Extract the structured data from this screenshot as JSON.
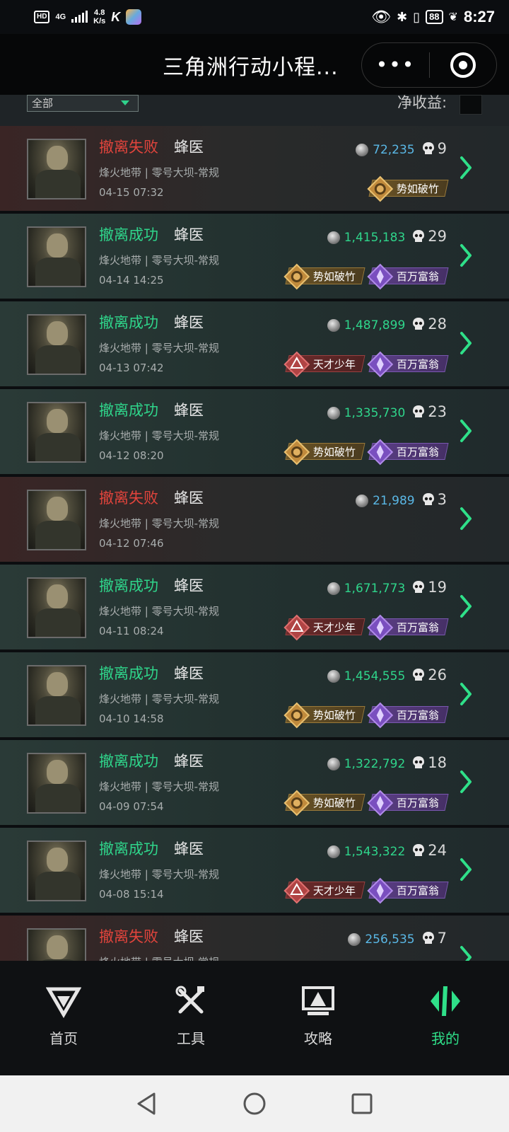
{
  "status_bar": {
    "hd": "HD",
    "net": "4G",
    "speed_value": "4.8",
    "speed_unit": "K/s",
    "app_icon": "K",
    "battery": "88",
    "time": "8:27"
  },
  "header": {
    "title": "三角洲行动小程...",
    "more_label": "•••"
  },
  "filter": {
    "select_value": "全部",
    "net_label": "净收益:"
  },
  "records": [
    {
      "status": "撤离失败",
      "result": "fail",
      "operator": "蜂医",
      "map": "烽火地带 | 零号大坝-常规",
      "time": "04-15 07:32",
      "value": "72,235",
      "kills": "9",
      "badges": [
        {
          "label": "势如破竹",
          "type": "gold"
        }
      ]
    },
    {
      "status": "撤离成功",
      "result": "ok",
      "operator": "蜂医",
      "map": "烽火地带 | 零号大坝-常规",
      "time": "04-14 14:25",
      "value": "1,415,183",
      "kills": "29",
      "badges": [
        {
          "label": "势如破竹",
          "type": "gold"
        },
        {
          "label": "百万富翁",
          "type": "purple"
        }
      ]
    },
    {
      "status": "撤离成功",
      "result": "ok",
      "operator": "蜂医",
      "map": "烽火地带 | 零号大坝-常规",
      "time": "04-13 07:42",
      "value": "1,487,899",
      "kills": "28",
      "badges": [
        {
          "label": "天才少年",
          "type": "red"
        },
        {
          "label": "百万富翁",
          "type": "purple"
        }
      ]
    },
    {
      "status": "撤离成功",
      "result": "ok",
      "operator": "蜂医",
      "map": "烽火地带 | 零号大坝-常规",
      "time": "04-12 08:20",
      "value": "1,335,730",
      "kills": "23",
      "badges": [
        {
          "label": "势如破竹",
          "type": "gold"
        },
        {
          "label": "百万富翁",
          "type": "purple"
        }
      ]
    },
    {
      "status": "撤离失败",
      "result": "fail",
      "operator": "蜂医",
      "map": "烽火地带 | 零号大坝-常规",
      "time": "04-12 07:46",
      "value": "21,989",
      "kills": "3",
      "badges": []
    },
    {
      "status": "撤离成功",
      "result": "ok",
      "operator": "蜂医",
      "map": "烽火地带 | 零号大坝-常规",
      "time": "04-11 08:24",
      "value": "1,671,773",
      "kills": "19",
      "badges": [
        {
          "label": "天才少年",
          "type": "red"
        },
        {
          "label": "百万富翁",
          "type": "purple"
        }
      ]
    },
    {
      "status": "撤离成功",
      "result": "ok",
      "operator": "蜂医",
      "map": "烽火地带 | 零号大坝-常规",
      "time": "04-10 14:58",
      "value": "1,454,555",
      "kills": "26",
      "badges": [
        {
          "label": "势如破竹",
          "type": "gold"
        },
        {
          "label": "百万富翁",
          "type": "purple"
        }
      ]
    },
    {
      "status": "撤离成功",
      "result": "ok",
      "operator": "蜂医",
      "map": "烽火地带 | 零号大坝-常规",
      "time": "04-09 07:54",
      "value": "1,322,792",
      "kills": "18",
      "badges": [
        {
          "label": "势如破竹",
          "type": "gold"
        },
        {
          "label": "百万富翁",
          "type": "purple"
        }
      ]
    },
    {
      "status": "撤离成功",
      "result": "ok",
      "operator": "蜂医",
      "map": "烽火地带 | 零号大坝-常规",
      "time": "04-08 15:14",
      "value": "1,543,322",
      "kills": "24",
      "badges": [
        {
          "label": "天才少年",
          "type": "red"
        },
        {
          "label": "百万富翁",
          "type": "purple"
        }
      ]
    },
    {
      "status": "撤离失败",
      "result": "fail",
      "operator": "蜂医",
      "map": "烽火地带 | 零号大坝-常规",
      "time": "",
      "value": "256,535",
      "kills": "7",
      "badges": []
    }
  ],
  "bottom_nav": [
    {
      "label": "首页",
      "icon": "home-logo-icon",
      "active": false
    },
    {
      "label": "工具",
      "icon": "tools-icon",
      "active": false
    },
    {
      "label": "攻略",
      "icon": "guide-icon",
      "active": false
    },
    {
      "label": "我的",
      "icon": "profile-icon",
      "active": true
    }
  ],
  "colors": {
    "success": "#2fd58b",
    "failure": "#e2443c",
    "value_blue": "#5ab8e6",
    "active_nav": "#2fe089"
  }
}
